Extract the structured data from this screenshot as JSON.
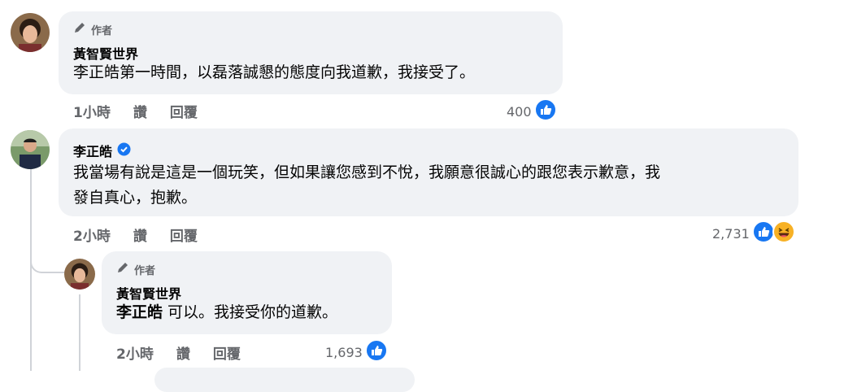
{
  "comments": [
    {
      "author_badge": "作者",
      "name": "黃智賢世界",
      "text": "李正皓第一時間，以磊落誠懇的態度向我道歉，我接受了。",
      "time": "1小時",
      "like_label": "讚",
      "reply_label": "回覆",
      "reaction_count": "400",
      "reaction_icons": [
        "like-icon"
      ]
    },
    {
      "name": "李正皓",
      "verified_icon": "verified-badge-icon",
      "text_line1": "我當場有說是這是一個玩笑，但如果讓您感到不悅，我願意很誠心的跟您表示歉意，我",
      "text_line2": "發自真心，抱歉。",
      "time": "2小時",
      "like_label": "讚",
      "reply_label": "回覆",
      "reaction_count": "2,731",
      "reaction_icons": [
        "like-icon",
        "haha-icon"
      ]
    },
    {
      "author_badge": "作者",
      "name": "黃智賢世界",
      "mention": "李正皓",
      "text": " 可以。我接受你的道歉。",
      "time": "2小時",
      "like_label": "讚",
      "reply_label": "回覆",
      "reaction_count": "1,693",
      "reaction_icons": [
        "like-icon"
      ]
    }
  ],
  "colors": {
    "like_blue": "#1877f2",
    "verified_blue": "#1877f2",
    "bubble_bg": "#f0f2f5",
    "muted_text": "#65676b"
  }
}
